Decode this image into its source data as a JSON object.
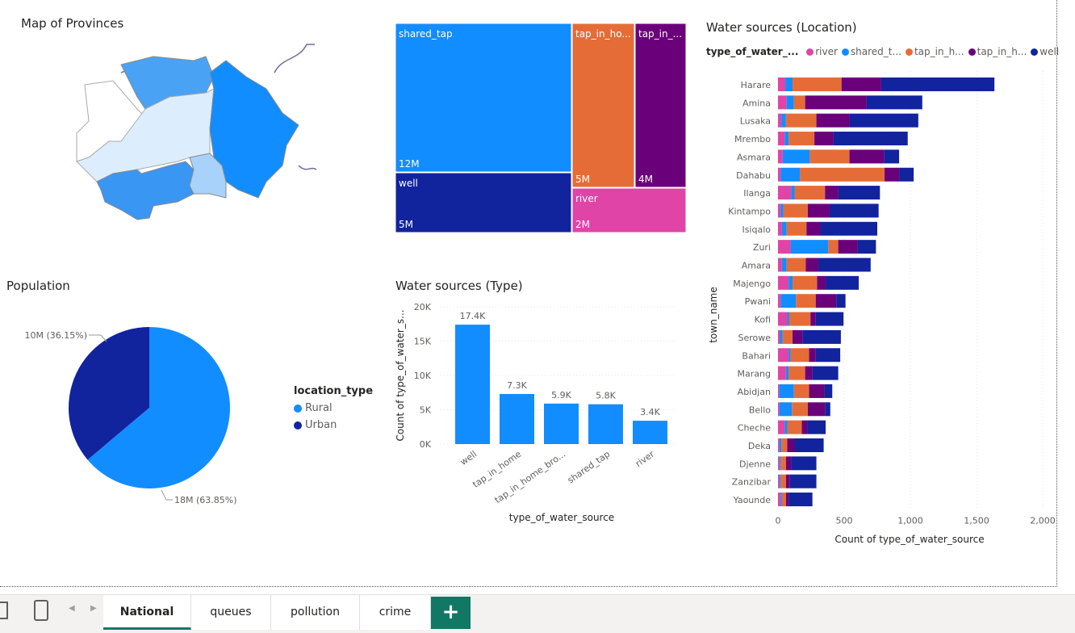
{
  "map": {
    "title": "Map of Provinces"
  },
  "population": {
    "title": "Population",
    "legend_title": "location_type",
    "slices": [
      {
        "name": "Rural",
        "value": 63.85,
        "label": "18M (63.85%)",
        "color": "#118DFF"
      },
      {
        "name": "Urban",
        "value": 36.15,
        "label": "10M (36.15%)",
        "color": "#12239E"
      }
    ]
  },
  "treemap": {
    "items": [
      {
        "name": "shared_tap",
        "label": "shared_tap",
        "value_label": "12M",
        "color": "#118DFF"
      },
      {
        "name": "well",
        "label": "well",
        "value_label": "5M",
        "color": "#12239E"
      },
      {
        "name": "tap_in_home",
        "label": "tap_in_ho...",
        "value_label": "5M",
        "color": "#E66C37"
      },
      {
        "name": "tap_in_home_broken",
        "label": "tap_in_...",
        "value_label": "4M",
        "color": "#6B007B"
      },
      {
        "name": "river",
        "label": "river",
        "value_label": "2M",
        "color": "#E044A7"
      }
    ]
  },
  "type_chart": {
    "title": "Water sources (Type)",
    "xlabel": "type_of_water_source",
    "ylabel": "Count of type_of_water_s...",
    "chart_data": {
      "type": "bar",
      "categories": [
        "well",
        "tap_in_home",
        "tap_in_home_bro...",
        "shared_tap",
        "river"
      ],
      "values": [
        17400,
        7300,
        5900,
        5800,
        3400
      ],
      "data_labels": [
        "17.4K",
        "7.3K",
        "5.9K",
        "5.8K",
        "3.4K"
      ],
      "yticks": [
        "0K",
        "5K",
        "10K",
        "15K",
        "20K"
      ],
      "ylim": [
        0,
        20000
      ],
      "color": "#118DFF"
    }
  },
  "location_chart": {
    "title": "Water sources (Location)",
    "legend_title": "type_of_water_...",
    "legend": [
      {
        "label": "river",
        "color": "#E044A7"
      },
      {
        "label": "shared_t...",
        "color": "#118DFF"
      },
      {
        "label": "tap_in_h...",
        "color": "#E66C37"
      },
      {
        "label": "tap_in_h...",
        "color": "#6B007B"
      },
      {
        "label": "well",
        "color": "#12239E"
      }
    ],
    "xlabel": "Count of type_of_water_source",
    "ylabel": "town_name",
    "xticks": [
      "0",
      "500",
      "1,000",
      "1,500",
      "2,000"
    ],
    "chart_data": {
      "type": "bar",
      "orientation": "horizontal",
      "stacked": true,
      "xlim": [
        0,
        2000
      ],
      "categories": [
        "Harare",
        "Amina",
        "Lusaka",
        "Mrembo",
        "Asmara",
        "Dahabu",
        "Ilanga",
        "Kintampo",
        "Isiqalo",
        "Zuri",
        "Amara",
        "Majengo",
        "Pwani",
        "Kofi",
        "Serowe",
        "Bahari",
        "Marang",
        "Abidjan",
        "Bello",
        "Cheche",
        "Deka",
        "Djenne",
        "Zanzibar",
        "Yaounde"
      ],
      "series": [
        {
          "name": "river",
          "color": "#E044A7",
          "values": [
            55,
            65,
            25,
            50,
            35,
            20,
            100,
            20,
            30,
            95,
            30,
            80,
            20,
            70,
            15,
            80,
            60,
            10,
            10,
            50,
            10,
            10,
            10,
            20
          ]
        },
        {
          "name": "shared_tap",
          "color": "#118DFF",
          "values": [
            55,
            55,
            35,
            30,
            205,
            145,
            25,
            20,
            35,
            285,
            35,
            30,
            115,
            15,
            20,
            15,
            20,
            110,
            95,
            20,
            15,
            10,
            10,
            10
          ]
        },
        {
          "name": "tap_in_home",
          "color": "#E66C37",
          "values": [
            370,
            85,
            230,
            195,
            300,
            640,
            230,
            185,
            150,
            75,
            145,
            185,
            150,
            160,
            75,
            140,
            125,
            115,
            120,
            110,
            45,
            40,
            40,
            30
          ]
        },
        {
          "name": "tap_in_home_broken",
          "color": "#6B007B",
          "values": [
            300,
            465,
            250,
            145,
            260,
            110,
            100,
            165,
            105,
            145,
            95,
            65,
            155,
            40,
            75,
            50,
            55,
            115,
            130,
            40,
            55,
            40,
            30,
            20
          ]
        },
        {
          "name": "well",
          "color": "#12239E",
          "values": [
            855,
            420,
            520,
            560,
            115,
            110,
            315,
            370,
            430,
            140,
            395,
            250,
            70,
            210,
            290,
            185,
            195,
            60,
            40,
            140,
            220,
            190,
            200,
            180
          ]
        }
      ]
    }
  },
  "tabs": [
    "National",
    "queues",
    "pollution",
    "crime"
  ],
  "add_tab_label": "+"
}
